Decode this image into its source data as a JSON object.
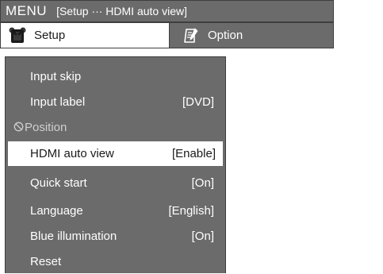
{
  "title_bar": {
    "menu_label": "MENU",
    "breadcrumb": "[Setup ··· HDMI auto view]"
  },
  "tabs": [
    {
      "label": "Setup",
      "icon": "wrench-icon",
      "active": true
    },
    {
      "label": "Option",
      "icon": "memo-pen-icon",
      "active": false
    }
  ],
  "menu": {
    "items": [
      {
        "label": "Input skip",
        "value": "",
        "state": "normal"
      },
      {
        "label": "Input label",
        "value": "[DVD]",
        "state": "normal"
      },
      {
        "label": "Position",
        "value": "",
        "state": "disabled"
      },
      {
        "label": "HDMI auto view",
        "value": "[Enable]",
        "state": "selected"
      },
      {
        "label": "Quick start",
        "value": "[On]",
        "state": "normal"
      },
      {
        "label": "Language",
        "value": "[English]",
        "state": "normal"
      },
      {
        "label": "Blue illumination",
        "value": "[On]",
        "state": "normal"
      },
      {
        "label": "Reset",
        "value": "",
        "state": "normal"
      }
    ]
  },
  "colors": {
    "panel_gray": "#6b6b6b",
    "border": "#3e3e3e",
    "highlight": "#ffffff",
    "text_light": "#ffffff",
    "text_dark": "#1a1a1a"
  }
}
